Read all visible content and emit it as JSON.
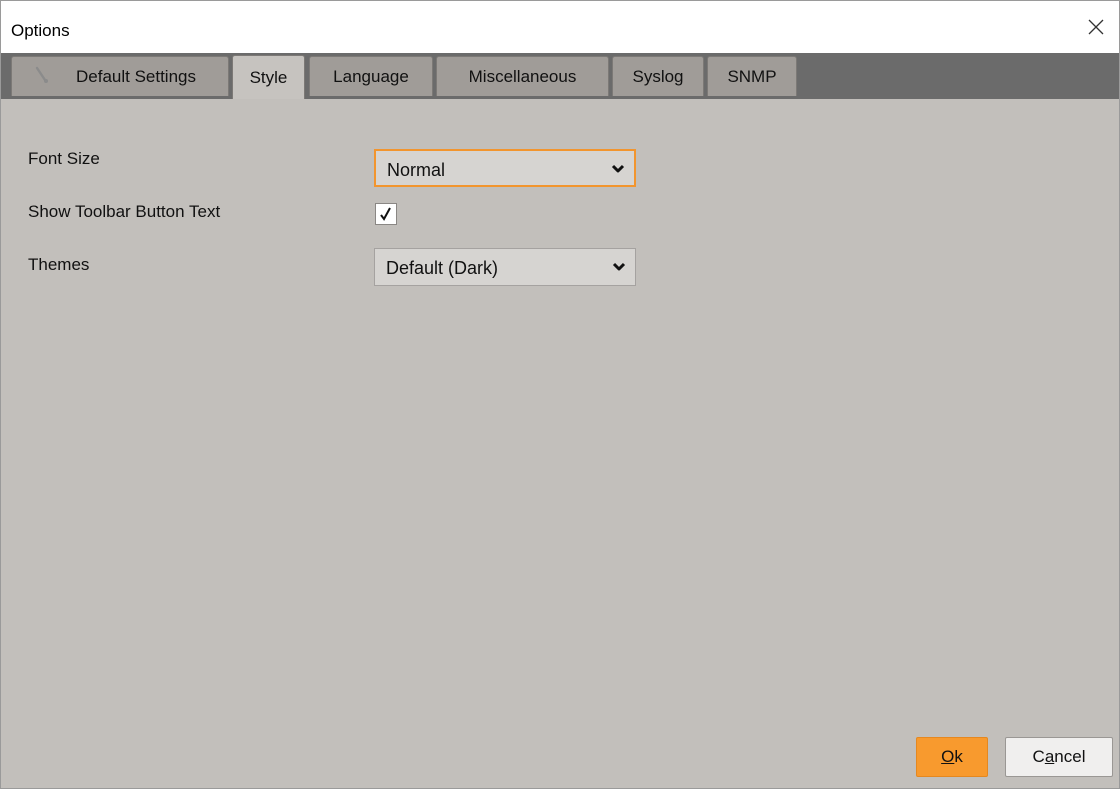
{
  "window": {
    "title": "Options",
    "close_icon": "close-icon"
  },
  "tabs": [
    {
      "label": "Default Settings",
      "icon": "wrench-icon",
      "active": false
    },
    {
      "label": "Style",
      "active": true
    },
    {
      "label": "Language",
      "active": false
    },
    {
      "label": "Miscellaneous",
      "active": false
    },
    {
      "label": "Syslog",
      "active": false
    },
    {
      "label": "SNMP",
      "active": false
    }
  ],
  "style": {
    "font_size_label": "Font Size",
    "font_size_value": "Normal",
    "toolbar_text_label": "Show Toolbar Button Text",
    "toolbar_text_checked": true,
    "themes_label": "Themes",
    "themes_value": "Default (Dark)"
  },
  "buttons": {
    "ok_mnemonic": "O",
    "ok_rest": "k",
    "cancel_pre": "C",
    "cancel_mnemonic": "a",
    "cancel_rest": "ncel"
  },
  "colors": {
    "accent": "#f89a2e",
    "tabbar": "#6b6b6b",
    "panel": "#c2bfbb"
  }
}
